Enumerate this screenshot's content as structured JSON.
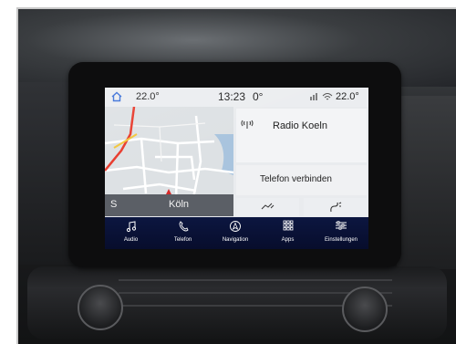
{
  "status_bar": {
    "outside_temp": "22.0°",
    "time": "13:23",
    "in_temp": "0°",
    "climate_temp": "22.0°"
  },
  "map": {
    "compass": "S",
    "city": "Köln"
  },
  "media": {
    "station": "Radio Koeln"
  },
  "phone": {
    "connect_label": "Telefon verbinden"
  },
  "nav_bar": {
    "items": [
      {
        "label": "Audio",
        "icon": "music-note-icon"
      },
      {
        "label": "Telefon",
        "icon": "phone-icon"
      },
      {
        "label": "Navigation",
        "icon": "navigation-icon"
      },
      {
        "label": "Apps",
        "icon": "apps-grid-icon"
      },
      {
        "label": "Einstellungen",
        "icon": "settings-sliders-icon"
      }
    ]
  },
  "colors": {
    "nav_bar": "#0a1338",
    "route": "#e8392b",
    "position_arrow": "#d62a2a",
    "accent": "#3a6fd8"
  }
}
